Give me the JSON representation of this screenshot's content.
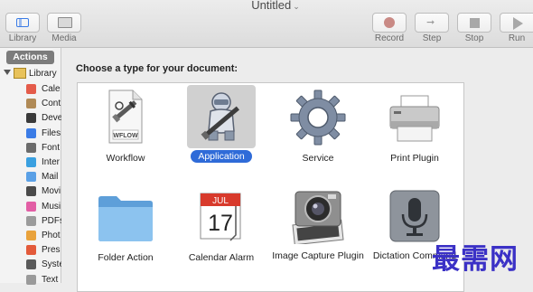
{
  "window": {
    "title": "Untitled"
  },
  "toolbar": {
    "library_label": "Library",
    "media_label": "Media",
    "record_label": "Record",
    "step_label": "Step",
    "stop_label": "Stop",
    "run_label": "Run"
  },
  "sidebar": {
    "actions_tab": "Actions",
    "library_label": "Library",
    "items": [
      {
        "label": "Cale",
        "icon": "calendar-icon"
      },
      {
        "label": "Cont",
        "icon": "contacts-icon"
      },
      {
        "label": "Deve",
        "icon": "developer-icon"
      },
      {
        "label": "Files",
        "icon": "files-icon"
      },
      {
        "label": "Font",
        "icon": "fonts-icon"
      },
      {
        "label": "Inter",
        "icon": "internet-icon"
      },
      {
        "label": "Mail",
        "icon": "mail-icon"
      },
      {
        "label": "Movi",
        "icon": "movies-icon"
      },
      {
        "label": "Musi",
        "icon": "music-icon"
      },
      {
        "label": "PDFs",
        "icon": "pdf-icon"
      },
      {
        "label": "Phot",
        "icon": "photos-icon"
      },
      {
        "label": "Pres",
        "icon": "presentations-icon"
      },
      {
        "label": "Syste",
        "icon": "system-icon"
      },
      {
        "label": "Text",
        "icon": "text-icon"
      }
    ]
  },
  "main": {
    "prompt": "Choose a type for your document:",
    "types": [
      {
        "label": "Workflow",
        "icon": "workflow-icon",
        "selected": false
      },
      {
        "label": "Application",
        "icon": "application-icon",
        "selected": true
      },
      {
        "label": "Service",
        "icon": "service-gear-icon",
        "selected": false
      },
      {
        "label": "Print Plugin",
        "icon": "printer-icon",
        "selected": false
      },
      {
        "label": "Folder Action",
        "icon": "folder-icon",
        "selected": false
      },
      {
        "label": "Calendar Alarm",
        "icon": "calendar-alarm-icon",
        "selected": false
      },
      {
        "label": "Image Capture Plugin",
        "icon": "camera-icon",
        "selected": false
      },
      {
        "label": "Dictation Command",
        "icon": "microphone-icon",
        "selected": false
      }
    ],
    "wflow_badge": "WFLOW",
    "calendar_month": "JUL",
    "calendar_day": "17"
  },
  "watermark": "最需网",
  "colors": {
    "selection": "#2f6bd8",
    "folder": "#7fb9ec",
    "watermark": "#3b31c6"
  }
}
